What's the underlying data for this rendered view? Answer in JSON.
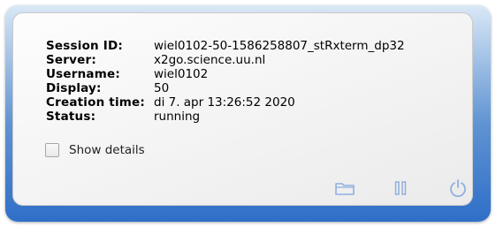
{
  "session": {
    "fields": [
      {
        "label": "Session ID:",
        "value": "wiel0102-50-1586258807_stRxterm_dp32"
      },
      {
        "label": "Server:",
        "value": "x2go.science.uu.nl"
      },
      {
        "label": "Username:",
        "value": "wiel0102"
      },
      {
        "label": "Display:",
        "value": "50"
      },
      {
        "label": "Creation time:",
        "value": "di 7. apr 13:26:52 2020"
      },
      {
        "label": "Status:",
        "value": "running"
      }
    ]
  },
  "details": {
    "label": "Show details",
    "checked": false
  },
  "actions": [
    {
      "icon": "folder-icon",
      "color": "#8fb0e0"
    },
    {
      "icon": "pause-icon",
      "color": "#8fb0e0"
    },
    {
      "icon": "power-icon",
      "color": "#8fb0e0"
    }
  ],
  "colors": {
    "frame": "#2f6fc8",
    "panel": "#f3f3f3",
    "icon": "#8fb0e0"
  }
}
